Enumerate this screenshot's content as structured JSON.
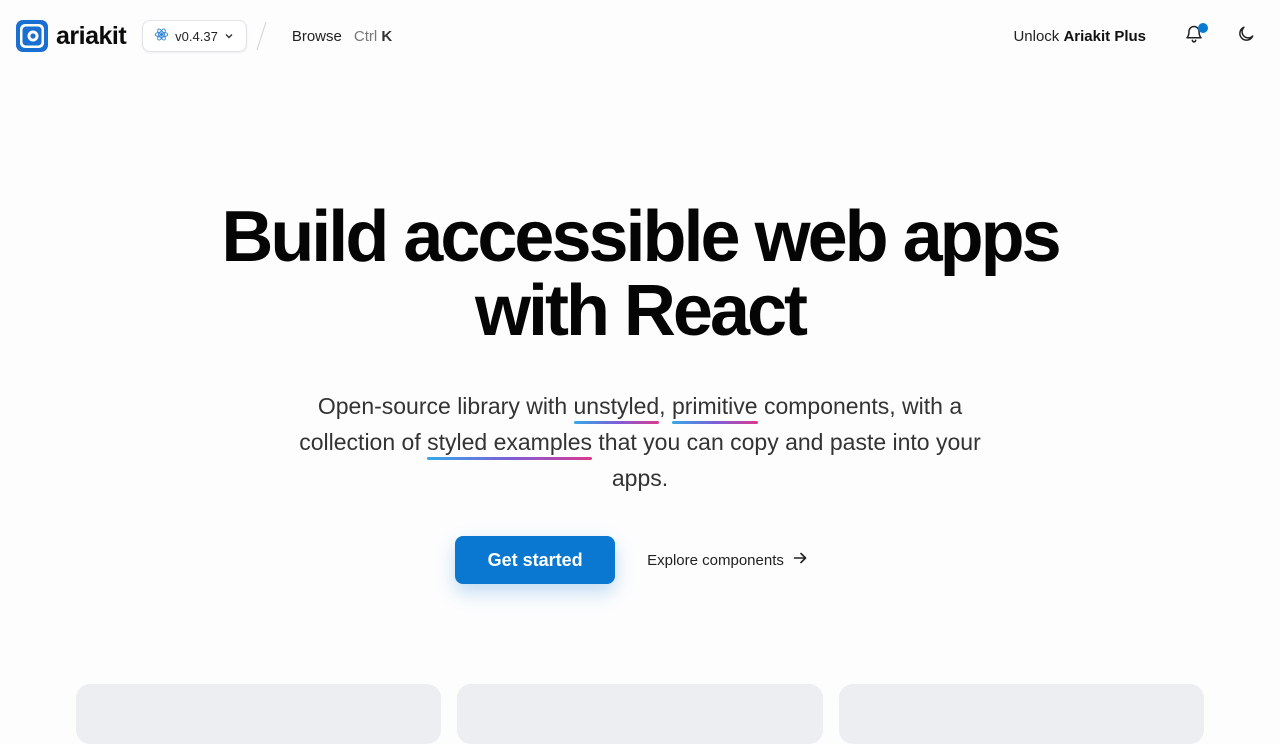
{
  "header": {
    "brand": "ariakit",
    "version": "v0.4.37",
    "browse_label": "Browse",
    "shortcut_mod": "Ctrl",
    "shortcut_key": "K",
    "unlock_prefix": "Unlock",
    "unlock_product": "Ariakit Plus"
  },
  "hero": {
    "title_line1": "Build accessible web apps",
    "title_line2": "with React",
    "sub_1": "Open-source library with ",
    "sub_unstyled": "unstyled",
    "sub_2": ", ",
    "sub_primitive": "primitive",
    "sub_3": " components, with a collection of ",
    "sub_styled": "styled examples",
    "sub_4": " that you can copy and paste into your apps."
  },
  "actions": {
    "primary_label": "Get started",
    "secondary_label": "Explore components"
  },
  "colors": {
    "accent": "#0a78d1",
    "notification_dot": "#0a7bd3"
  },
  "icons": [
    "ariakit-logo-icon",
    "react-icon",
    "chevron-down-icon",
    "bell-icon",
    "moon-icon",
    "arrow-right-icon"
  ]
}
